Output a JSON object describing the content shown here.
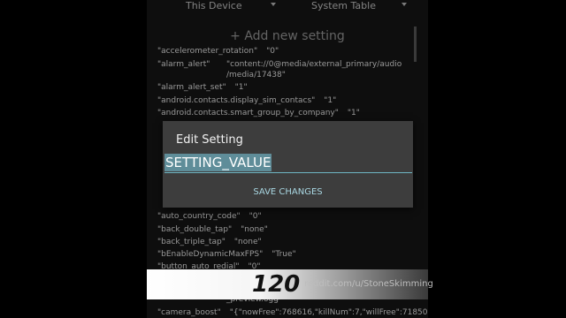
{
  "toolbar": {
    "device_spinner": "This Device",
    "table_spinner": "System Table"
  },
  "add_setting_label": "+ Add new setting",
  "settings": [
    {
      "key": "\"accelerometer_rotation\"",
      "value": "\"0\""
    },
    {
      "key": "\"alarm_alert\"",
      "value": "\"content://0@media/external_primary/audio\n/media/17438\""
    },
    {
      "key": "\"alarm_alert_set\"",
      "value": "\"1\""
    },
    {
      "key": "\"android.contacts.display_sim_contacs\"",
      "value": "\"1\""
    },
    {
      "key": "\"android.contacts.smart_group_by_company\"",
      "value": "\"1\""
    },
    {
      "key": "\"auto_country_code\"",
      "value": "\"0\""
    },
    {
      "key": "\"back_double_tap\"",
      "value": "\"none\""
    },
    {
      "key": "\"back_triple_tap\"",
      "value": "\"none\""
    },
    {
      "key": "\"bEnableDynamicMaxFPS\"",
      "value": "\"True\""
    },
    {
      "key": "\"button_auto_redial\"",
      "value": "\"0\""
    },
    {
      "key": "_preview.ogg",
      "value": ""
    },
    {
      "key": "\"camera_boost\"",
      "value": "\"{\"nowFree\":768616,\"killNum\":7,\"willFree\":71850"
    }
  ],
  "dialog": {
    "title": "Edit Setting",
    "input_value": "SETTING_VALUE",
    "save_button": "SAVE CHANGES"
  },
  "banner": {
    "number": "120",
    "watermark": "reddit.com/u/StoneSkimming"
  }
}
